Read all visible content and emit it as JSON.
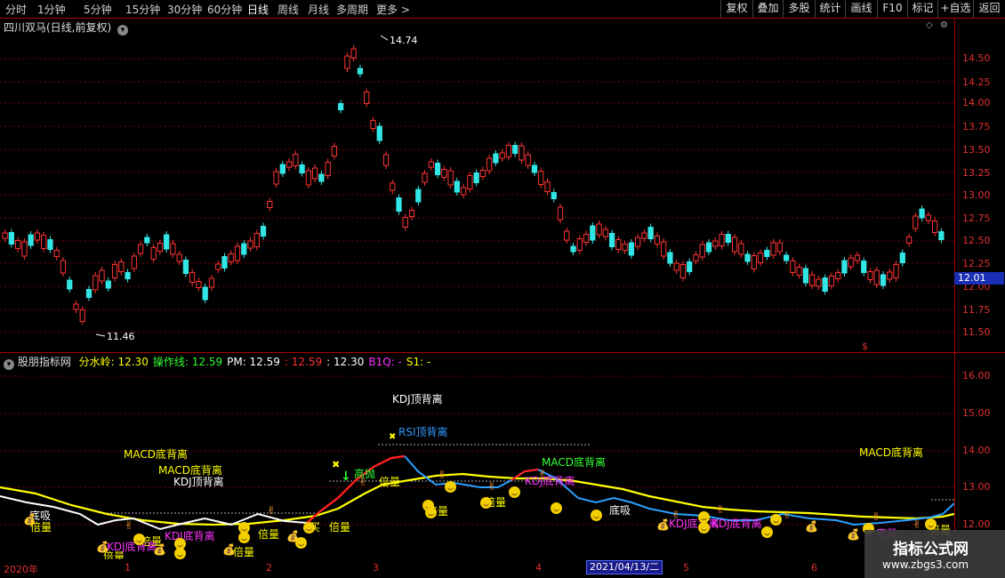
{
  "toolbar": {
    "timeframes": [
      "分时",
      "1分钟",
      "5分钟",
      "15分钟",
      "30分钟",
      "60分钟",
      "日线",
      "周线",
      "月线",
      "多周期",
      "更多 >"
    ],
    "active_timeframe": "日线",
    "right_buttons": [
      "复权",
      "叠加",
      "多股",
      "统计",
      "画线",
      "F10",
      "标记",
      "+自选",
      "返回"
    ]
  },
  "price_panel": {
    "title": "四川双马(日线,前复权)",
    "high_label": "14.74",
    "low_label": "11.46",
    "current_price": "12.01",
    "axis_ticks": [
      "14.50",
      "14.25",
      "14.00",
      "13.75",
      "13.50",
      "13.25",
      "13.00",
      "12.75",
      "12.50",
      "12.25",
      "12.00",
      "11.75",
      "11.50"
    ],
    "dollar_marker": "$"
  },
  "indicator_panel": {
    "name": "股朋指标网",
    "fields": [
      {
        "label": "分水岭:",
        "value": "12.30",
        "color": "#ffff00"
      },
      {
        "label": "操作线:",
        "value": "12.59",
        "color": "#33ff33"
      },
      {
        "label": "PM:",
        "value": "12.59",
        "color": "#ffffff"
      },
      {
        "label": ":",
        "value": "12.59",
        "color": "#ff3333"
      },
      {
        "label": ":",
        "value": "12.30",
        "color": "#ffffff"
      },
      {
        "label": "B1Q:",
        "value": "-",
        "color": "#ff33ff"
      },
      {
        "label": "S1:",
        "value": "-",
        "color": "#ffff00"
      }
    ],
    "axis_ticks": [
      "16.00",
      "15.00",
      "14.00",
      "13.00",
      "12.00"
    ],
    "annotations": [
      {
        "text": "KDJ顶背离",
        "color": "#ffffff"
      },
      {
        "text": "RSI顶背离",
        "color": "#3399ff"
      },
      {
        "text": "MACD底背离",
        "color": "#ffff00"
      },
      {
        "text": "MACD底背离",
        "color": "#ffff00"
      },
      {
        "text": "KDJ顶背离",
        "color": "#ffffff"
      },
      {
        "text": "MACD底背离",
        "color": "#33ff33"
      },
      {
        "text": "MACD底背离",
        "color": "#ffff00"
      },
      {
        "text": "高抛",
        "color": "#33ff33"
      },
      {
        "text": "倍量",
        "color": "#ffff00"
      },
      {
        "text": "倍量",
        "color": "#ffff00"
      },
      {
        "text": "倍量",
        "color": "#ffff00"
      },
      {
        "text": "倍量",
        "color": "#ffff00"
      },
      {
        "text": "倍量",
        "color": "#ffff00"
      },
      {
        "text": "倍量",
        "color": "#ffff00"
      },
      {
        "text": "倍量",
        "color": "#ffff00"
      },
      {
        "text": "倍量",
        "color": "#ffff00"
      },
      {
        "text": "倍量",
        "color": "#ffff00"
      },
      {
        "text": "倍量",
        "color": "#ffff00"
      },
      {
        "text": "底吸",
        "color": "#ffffff"
      },
      {
        "text": "底吸",
        "color": "#ffffff"
      },
      {
        "text": "KDJ底背离",
        "color": "#ff33ff"
      },
      {
        "text": "KDJ底背离",
        "color": "#ff33ff"
      },
      {
        "text": "KDJ底背离",
        "color": "#ff33ff"
      },
      {
        "text": "KDJ底背离",
        "color": "#ff33ff"
      },
      {
        "text": "KDJ底背离",
        "color": "#ff33ff"
      },
      {
        "text": "买",
        "color": "#ffff00"
      },
      {
        "text": "底背",
        "color": "#ff33ff"
      }
    ]
  },
  "date_axis": {
    "labels": [
      "2020年",
      "1",
      "2",
      "3",
      "4",
      "5",
      "6"
    ],
    "cursor_date": "2021/04/13/二"
  },
  "watermark": {
    "line1": "指标公式网",
    "line2": "www.zbgs3.com"
  },
  "colors": {
    "up": "#ff3333",
    "down": "#33e6e6",
    "axis": "#e03030",
    "grid": "#8b0000",
    "ma_yellow": "#ffff00",
    "ma_white": "#ffffff",
    "ma_blue": "#2aa0ff",
    "ma_red": "#ff2020"
  }
}
